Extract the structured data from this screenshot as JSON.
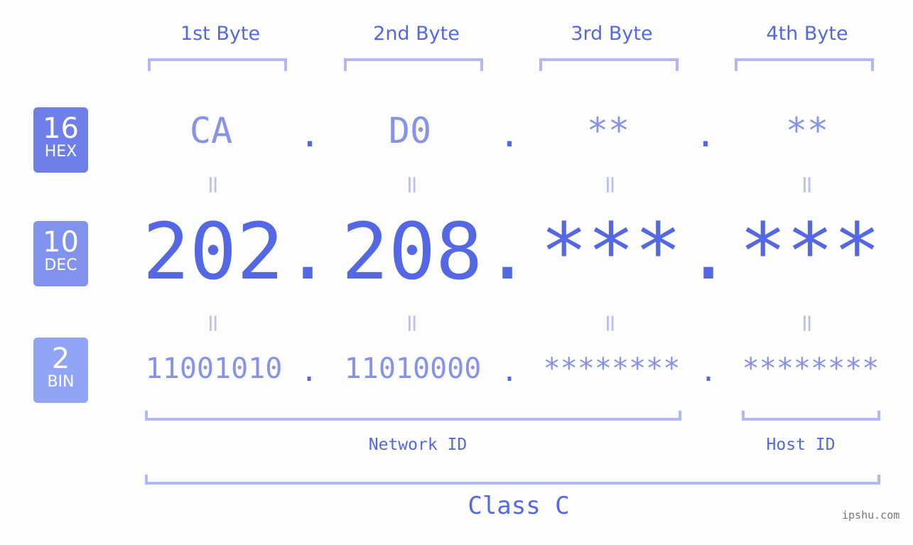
{
  "bytes": [
    {
      "label": "1st Byte",
      "hex": "CA",
      "dec": "202",
      "bin": "11001010"
    },
    {
      "label": "2nd Byte",
      "hex": "D0",
      "dec": "208",
      "bin": "11010000"
    },
    {
      "label": "3rd Byte",
      "hex": "**",
      "dec": "***",
      "bin": "********"
    },
    {
      "label": "4th Byte",
      "hex": "**",
      "dec": "***",
      "bin": "********"
    }
  ],
  "badges": [
    {
      "num": "16",
      "label": "HEX",
      "color": "#6f7fe9"
    },
    {
      "num": "10",
      "label": "DEC",
      "color": "#8292ef"
    },
    {
      "num": "2",
      "label": "BIN",
      "color": "#91a4f5"
    }
  ],
  "separator": ".",
  "equals": "=",
  "network_label": "Network ID",
  "host_label": "Host ID",
  "class_label": "Class C",
  "watermark": "ipshu.com"
}
